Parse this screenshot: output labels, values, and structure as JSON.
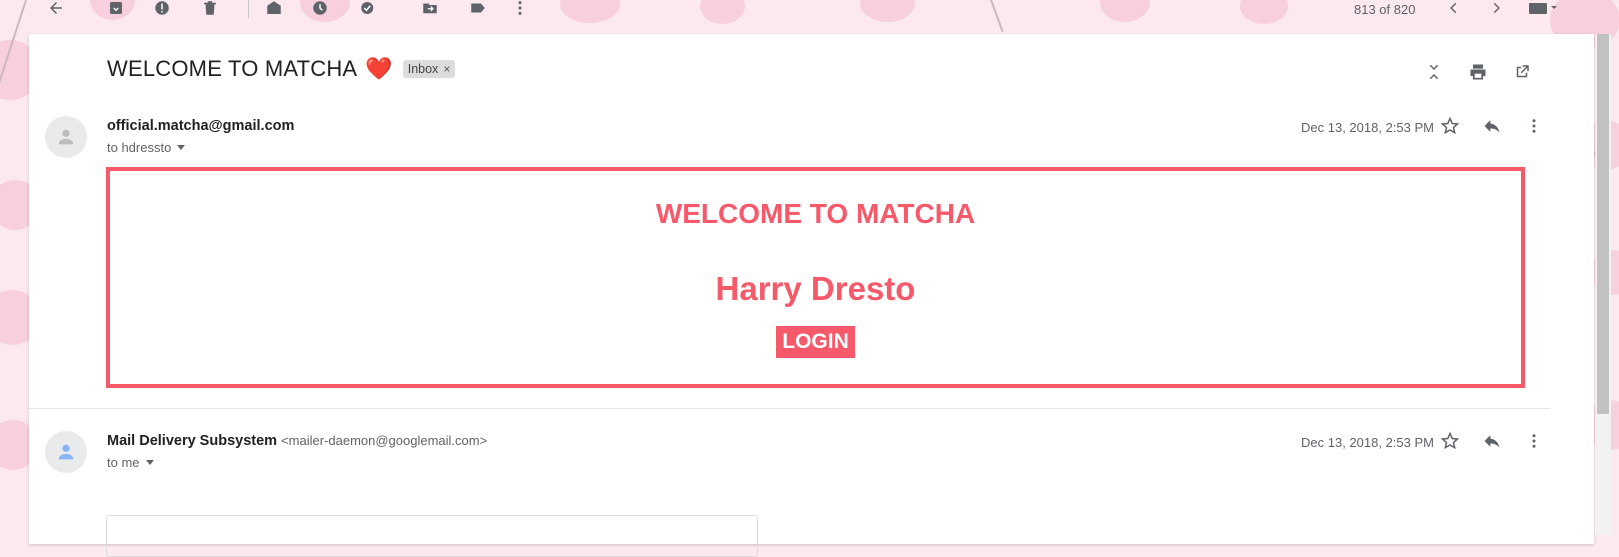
{
  "toolbar": {
    "icons": [
      "back-arrow-icon",
      "archive-icon",
      "report-spam-icon",
      "delete-icon",
      "mark-unread-icon",
      "snooze-icon",
      "add-task-icon",
      "move-to-icon",
      "label-icon",
      "more-vert-icon"
    ],
    "count": "813 of 820"
  },
  "thread": {
    "subject": "WELCOME TO MATCHA",
    "heart": "❤️",
    "label": "Inbox",
    "label_remove": "×"
  },
  "messages": [
    {
      "sender": "official.matcha@gmail.com",
      "sender_email": "",
      "to": "to hdressto",
      "date": "Dec 13, 2018, 2:53 PM"
    },
    {
      "sender": "Mail Delivery Subsystem",
      "sender_email": "<mailer-daemon@googlemail.com>",
      "to": "to me",
      "date": "Dec 13, 2018, 2:53 PM"
    }
  ],
  "email_body": {
    "title": "WELCOME TO MATCHA",
    "name": "Harry Dresto",
    "button": "LOGIN",
    "accent": "#f65a6a"
  }
}
